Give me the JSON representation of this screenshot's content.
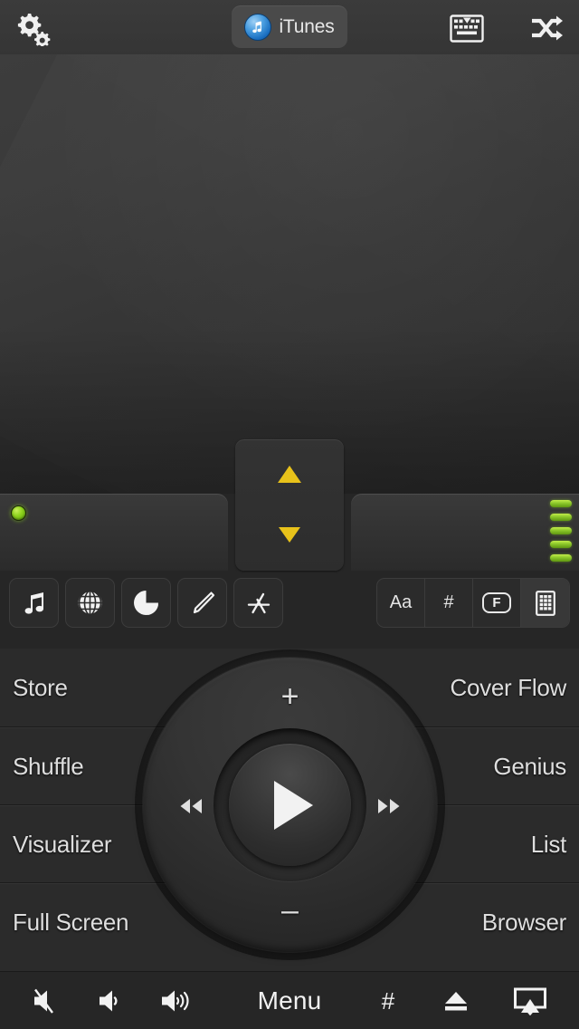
{
  "app": {
    "title": "iTunes",
    "accent_yellow": "#e8c21a",
    "accent_green": "#8bc72a",
    "accent_blue": "#1a6ec0"
  },
  "topbar": {
    "settings_icon": "gears-icon",
    "app_label": "iTunes",
    "app_logo_icon": "itunes-logo-icon",
    "keyboard_icon": "hide-keyboard-icon",
    "shuffle_icon": "shuffle-icon"
  },
  "screen": {
    "content": ""
  },
  "dpad": {
    "up_icon": "triangle-up-icon",
    "down_icon": "triangle-down-icon"
  },
  "status": {
    "led_icon": "power-led-icon",
    "meter_bars": 5
  },
  "source_buttons": [
    {
      "name": "music",
      "icon": "music-note-icon"
    },
    {
      "name": "internet",
      "icon": "globe-icon"
    },
    {
      "name": "podcast",
      "icon": "pie-chart-icon"
    },
    {
      "name": "edit",
      "icon": "pencil-icon"
    },
    {
      "name": "app-store",
      "icon": "app-store-icon"
    }
  ],
  "view_buttons": [
    {
      "label": "Aa",
      "icon": "text-size-icon",
      "selected": false
    },
    {
      "label": "#",
      "icon": "number-icon",
      "selected": false
    },
    {
      "label": "F",
      "icon": "f-key-icon",
      "selected": false
    },
    {
      "label": "",
      "icon": "grid-view-icon",
      "selected": true
    }
  ],
  "menu_rows": [
    {
      "left": "Store",
      "right": "Cover Flow"
    },
    {
      "left": "Shuffle",
      "right": "Genius"
    },
    {
      "left": "Visualizer",
      "right": "List"
    },
    {
      "left": "Full Screen",
      "right": "Browser"
    }
  ],
  "wheel": {
    "plus_label": "+",
    "minus_label": "–",
    "prev_icon": "rewind-icon",
    "next_icon": "fast-forward-icon",
    "play_icon": "play-icon"
  },
  "bottombar": {
    "mute_icon": "volume-mute-icon",
    "volume_down_icon": "volume-down-icon",
    "volume_up_icon": "volume-up-icon",
    "menu_label": "Menu",
    "hash_label": "#",
    "eject_icon": "eject-icon",
    "airplay_icon": "airplay-icon"
  }
}
